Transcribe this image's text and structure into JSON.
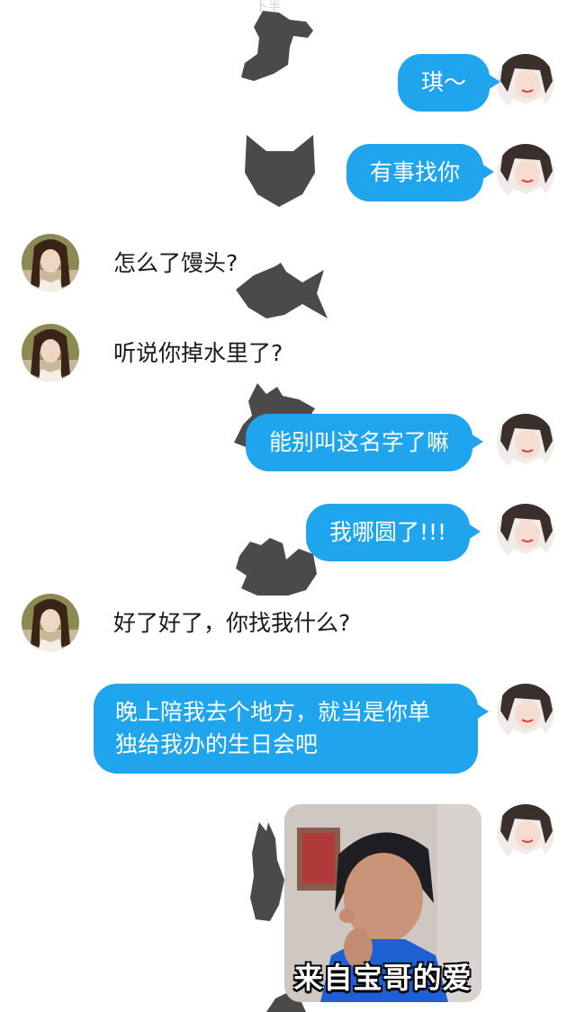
{
  "status_bar": {
    "fragment": "卜半"
  },
  "contacts": {
    "me": {
      "name": ""
    },
    "friend": {
      "name": ""
    }
  },
  "messages": [
    {
      "side": "right",
      "text": "琪～"
    },
    {
      "side": "right",
      "text": "有事找你"
    },
    {
      "side": "left",
      "text": "怎么了馒头?"
    },
    {
      "side": "left",
      "text": "听说你掉水里了?"
    },
    {
      "side": "right",
      "text": "能别叫这名字了嘛"
    },
    {
      "side": "right",
      "text": "我哪圆了!!!"
    },
    {
      "side": "left",
      "text": "好了好了，你找我什么?"
    },
    {
      "side": "right",
      "lines": [
        "晚上陪我去个地方，就当是你单",
        "独给我办的生日会吧"
      ]
    },
    {
      "side": "right",
      "sticker_caption": "来自宝哥的爱"
    }
  ],
  "colors": {
    "bubble_right": "#1fa5ee",
    "silhouette": "#4a4a4a"
  }
}
